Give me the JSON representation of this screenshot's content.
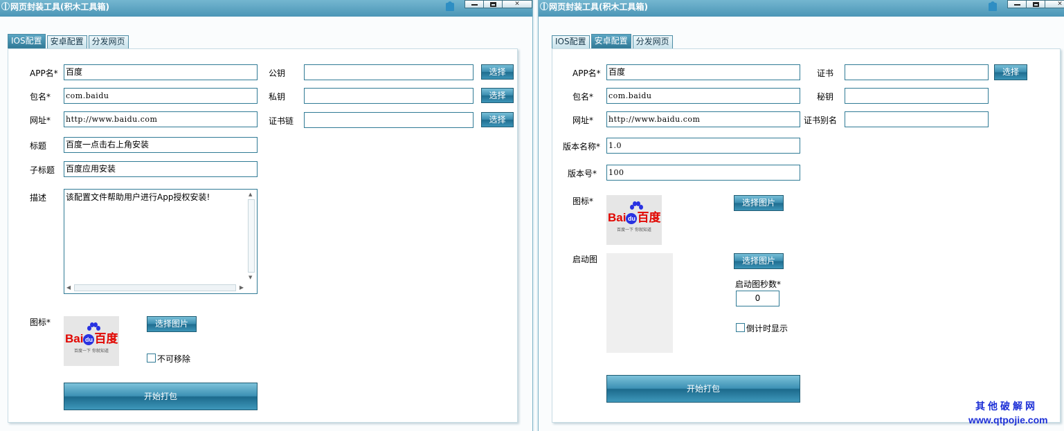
{
  "window_title": "网页封装工具(积木工具箱)",
  "window_buttons": {
    "minimize": "minimize-icon",
    "maximize": "maximize-icon",
    "close": "×"
  },
  "tabs": [
    "IOS配置",
    "安卓配置",
    "分发网页"
  ],
  "ios": {
    "active_tab": "IOS配置",
    "labels": {
      "app_name": "APP名*",
      "package": "包名*",
      "url": "网址*",
      "title": "标题",
      "subtitle": "子标题",
      "desc": "描述",
      "icon": "图标*",
      "public_key": "公钥",
      "private_key": "私钥",
      "cert_chain": "证书链"
    },
    "values": {
      "app_name": "百度",
      "package": "com.baidu",
      "url": "http://www.baidu.com",
      "title": "百度一点击右上角安装",
      "subtitle": "百度应用安装",
      "desc": "该配置文件帮助用户进行App授权安装!",
      "public_key": "",
      "private_key": "",
      "cert_chain": ""
    },
    "select_label": "选择",
    "select_image_label": "选择图片",
    "not_removable_label": "不可移除",
    "not_removable_checked": false,
    "build_label": "开始打包"
  },
  "android": {
    "active_tab": "安卓配置",
    "labels": {
      "app_name": "APP名*",
      "package": "包名*",
      "url": "网址*",
      "version_name": "版本名称*",
      "version_code": "版本号*",
      "icon": "图标*",
      "splash": "启动图",
      "cert": "证书",
      "secret_key": "秘钥",
      "cert_alias": "证书别名",
      "splash_seconds": "启动图秒数*",
      "countdown": "倒计时显示"
    },
    "values": {
      "app_name": "百度",
      "package": "com.baidu",
      "url": "http://www.baidu.com",
      "version_name": "1.0",
      "version_code": "100",
      "cert": "",
      "secret_key": "",
      "cert_alias": "",
      "splash_seconds": "0"
    },
    "select_label": "选择",
    "select_image_label": "选择图片",
    "countdown_checked": false,
    "build_label": "开始打包"
  },
  "logo": {
    "word_left": "Bai",
    "word_du": "du",
    "word_right": "百度",
    "slogan": "百度一下 你就知道"
  },
  "watermark": {
    "line1": "其他破解网",
    "line2": "www.qtpojie.com"
  }
}
